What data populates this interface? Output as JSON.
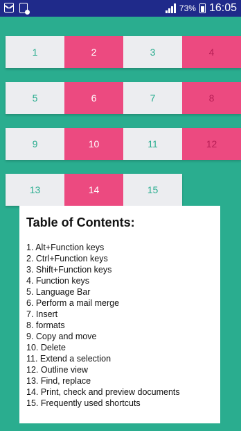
{
  "status_bar": {
    "battery_percent": "73%",
    "time": "16:05",
    "icons": [
      "mail-icon",
      "phone-icon",
      "signal-icon",
      "battery-icon"
    ]
  },
  "grid": [
    [
      "1",
      "2",
      "3",
      "4"
    ],
    [
      "5",
      "6",
      "7",
      "8"
    ],
    [
      "9",
      "10",
      "11",
      "12"
    ],
    [
      "13",
      "14",
      "15"
    ]
  ],
  "toc": {
    "title": "Table of Contents:",
    "items": [
      "1. Alt+Function keys",
      "2. Ctrl+Function keys",
      "3. Shift+Function keys",
      "4. Function keys",
      "5. Language Bar",
      "6. Perform a mail merge",
      "7. Insert",
      "8. formats",
      "9. Copy and move",
      "10. Delete",
      "11. Extend a selection",
      "12. Outline view",
      "13. Find, replace",
      "14. Print, check and preview documents",
      "15. Frequently used shortcuts"
    ]
  },
  "colors": {
    "background": "#2aad8f",
    "status_bar": "#1f2a8a",
    "tile_light": "#ecedf0",
    "tile_pink": "#ec4a80"
  }
}
